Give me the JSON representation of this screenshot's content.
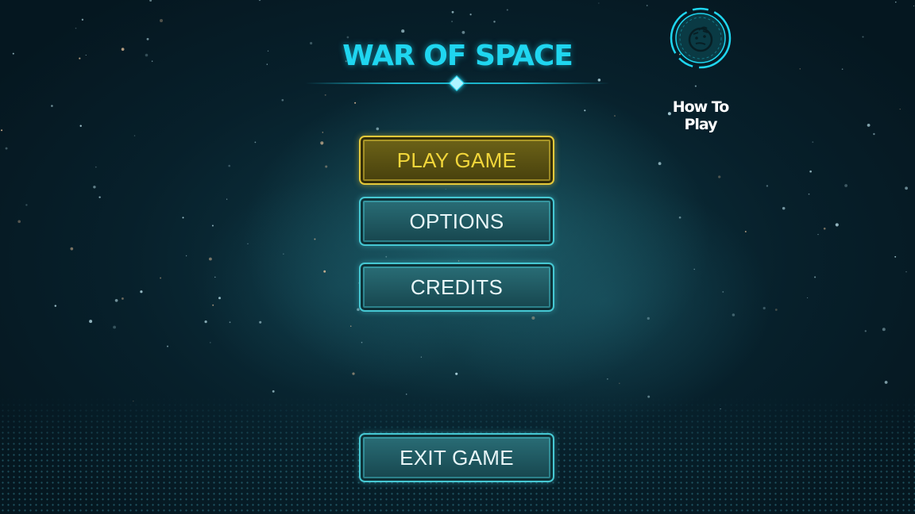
{
  "game": {
    "title": "WAR OF SPACE"
  },
  "menu": {
    "play_label": "PLAY GAME",
    "options_label": "OPTIONS",
    "credits_label": "CREDITS",
    "exit_label": "EXIT GAME"
  },
  "how_to_play": {
    "label": "How To Play",
    "icon": "thinking-face-icon"
  },
  "colors": {
    "title": "#1fd6f0",
    "primary_button_text": "#f2d63a",
    "primary_button_border": "#e6c93a",
    "button_border": "#46c8d3",
    "button_text": "#e8f6f8",
    "background": "#07202b"
  }
}
